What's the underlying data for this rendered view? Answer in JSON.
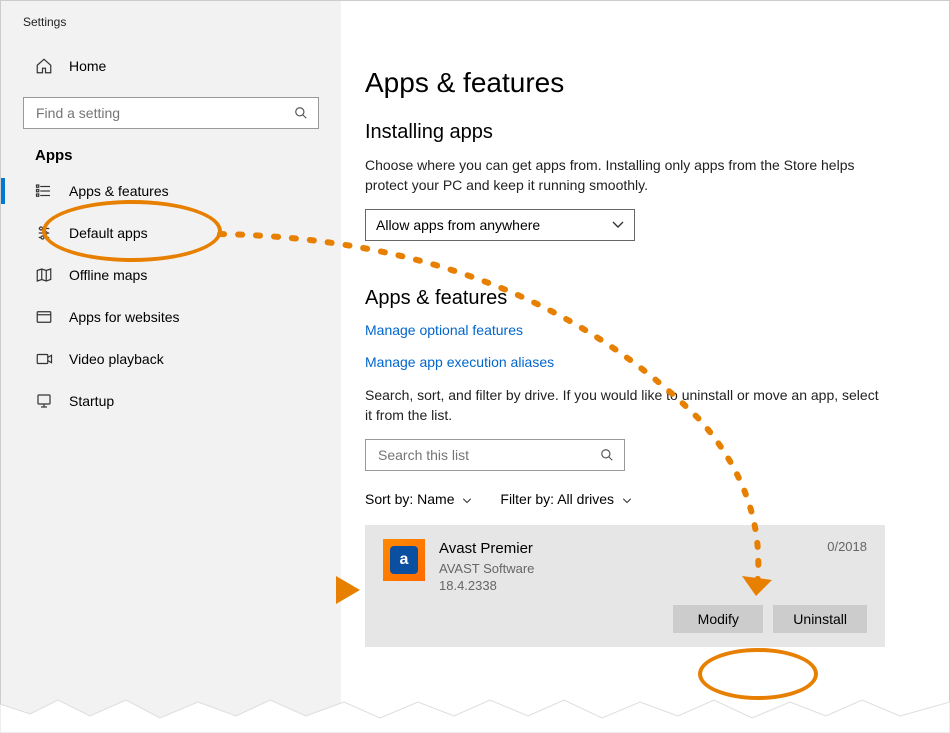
{
  "window": {
    "title": "Settings"
  },
  "sidebar": {
    "home": "Home",
    "search_placeholder": "Find a setting",
    "section": "Apps",
    "items": [
      {
        "label": "Apps & features",
        "active": true
      },
      {
        "label": "Default apps"
      },
      {
        "label": "Offline maps"
      },
      {
        "label": "Apps for websites"
      },
      {
        "label": "Video playback"
      },
      {
        "label": "Startup"
      }
    ]
  },
  "main": {
    "title": "Apps & features",
    "installing": {
      "heading": "Installing apps",
      "body": "Choose where you can get apps from. Installing only apps from the Store helps protect your PC and keep it running smoothly.",
      "select": "Allow apps from anywhere"
    },
    "apps": {
      "heading": "Apps & features",
      "link_optional": "Manage optional features",
      "link_aliases": "Manage app execution aliases",
      "instructions": "Search, sort, and filter by drive. If you would like to uninstall or move an app, select it from the list.",
      "search_placeholder": "Search this list",
      "sort_label": "Sort by:",
      "sort_value": "Name",
      "filter_label": "Filter by:",
      "filter_value": "All drives"
    },
    "app_item": {
      "name": "Avast Premier",
      "publisher": "AVAST Software",
      "version": "18.4.2338",
      "date": "0/2018",
      "modify": "Modify",
      "uninstall": "Uninstall"
    }
  },
  "colors": {
    "accent": "#0078d4",
    "link": "#0066cc",
    "anno": "#e77f00"
  }
}
